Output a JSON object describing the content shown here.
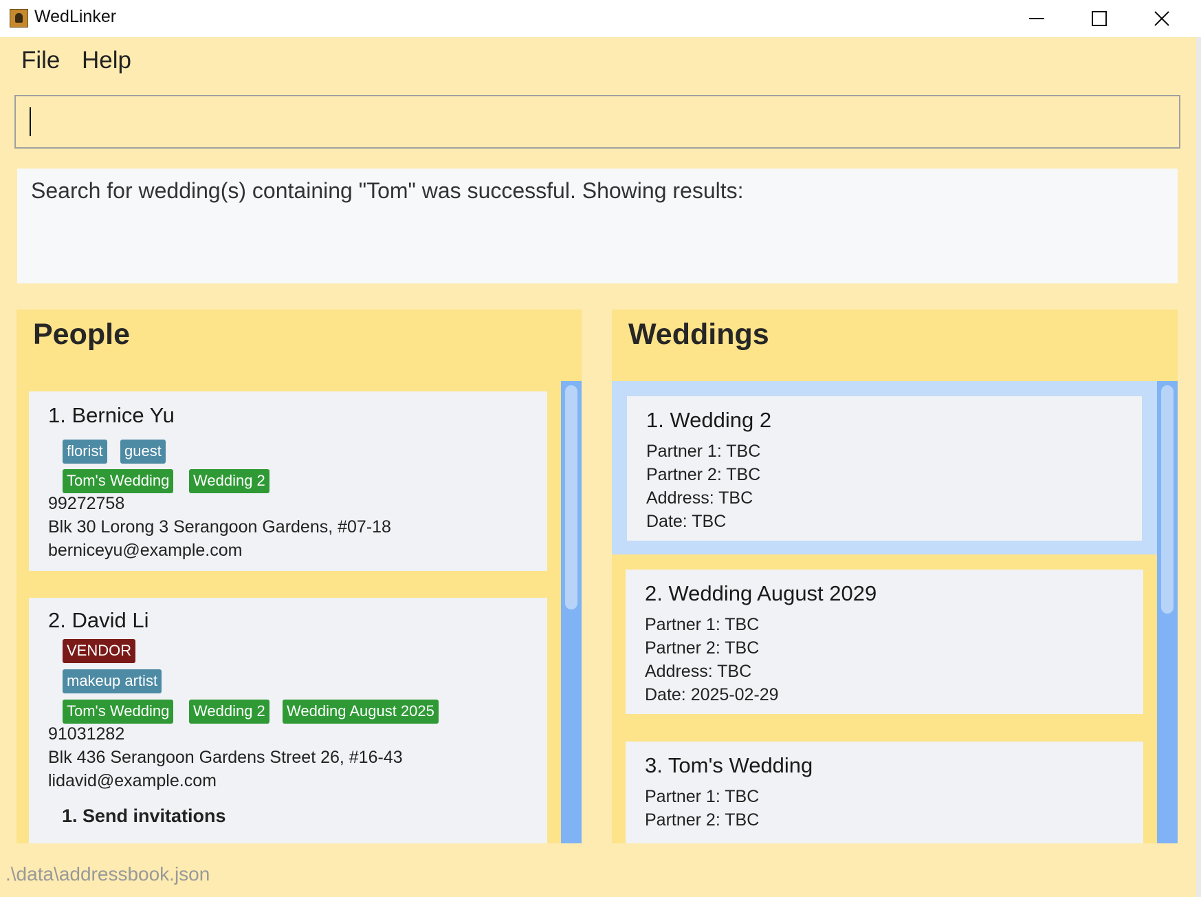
{
  "window": {
    "title": "WedLinker"
  },
  "menu": {
    "file": "File",
    "help": "Help"
  },
  "command": {
    "value": ""
  },
  "result": {
    "message": "Search for wedding(s) containing \"Tom\" was successful. Showing results:"
  },
  "people": {
    "title": "People",
    "items": [
      {
        "name": "1. Bernice Yu",
        "roles": [
          "florist",
          "guest"
        ],
        "weddings": [
          "Tom's Wedding",
          "Wedding 2"
        ],
        "phone": "99272758",
        "address": "Blk 30 Lorong 3 Serangoon Gardens, #07-18",
        "email": "berniceyu@example.com"
      },
      {
        "name": "2. David Li",
        "vendor_tag": "VENDOR",
        "roles": [
          "makeup artist"
        ],
        "weddings": [
          "Tom's Wedding",
          "Wedding 2",
          "Wedding August 2025"
        ],
        "phone": "91031282",
        "address": "Blk 436 Serangoon Gardens Street 26, #16-43",
        "email": "lidavid@example.com",
        "task": "1. Send invitations"
      }
    ]
  },
  "weddings": {
    "title": "Weddings",
    "items": [
      {
        "name": "1. Wedding 2",
        "partner1": "Partner 1: TBC",
        "partner2": "Partner 2: TBC",
        "address": "Address: TBC",
        "date": "Date: TBC",
        "selected": true
      },
      {
        "name": "2. Wedding August 2029",
        "partner1": "Partner 1: TBC",
        "partner2": "Partner 2: TBC",
        "address": "Address: TBC",
        "date": "Date: 2025-02-29",
        "selected": false
      },
      {
        "name": "3. Tom's Wedding",
        "partner1": "Partner 1: TBC",
        "partner2": "Partner 2: TBC",
        "selected": false
      }
    ]
  },
  "status": {
    "path": ".\\data\\addressbook.json"
  },
  "colors": {
    "background": "#fdebb1",
    "panel": "#fde389",
    "card": "#f0f2f5",
    "selected": "#c2dcf9",
    "role_tag": "#4d8aa4",
    "wedding_tag": "#2f9a35",
    "vendor_tag": "#7a1a18",
    "scrollbar": "#7fb3f5"
  }
}
